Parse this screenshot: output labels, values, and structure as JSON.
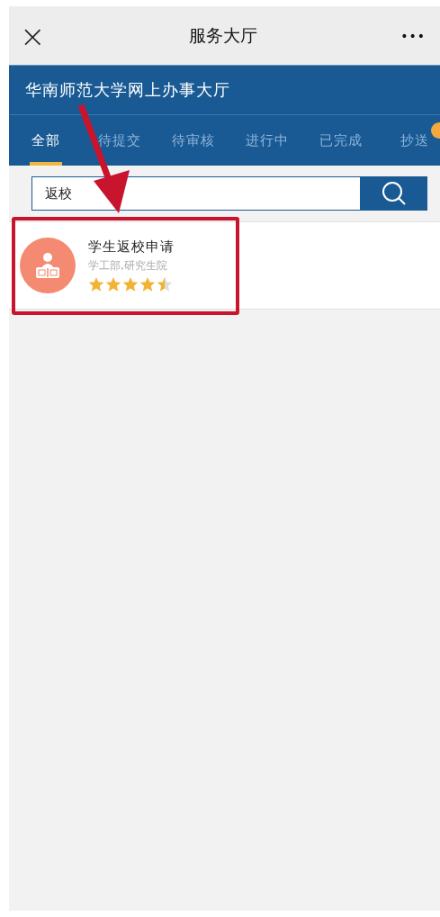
{
  "nav_bar": {
    "close": "×",
    "title": "服务大厅",
    "more": "•••"
  },
  "header": {
    "title": "华南师范大学网上办事大厅"
  },
  "tabs": [
    {
      "label": "全部",
      "selected": true
    },
    {
      "label": "待提交",
      "selected": false
    },
    {
      "label": "待审核",
      "selected": false
    },
    {
      "label": "进行中",
      "selected": false
    },
    {
      "label": "已完成",
      "selected": false
    },
    {
      "label": "抄送",
      "selected": false
    }
  ],
  "search": {
    "value": "返校"
  },
  "results": [
    {
      "title": "学生返校申请",
      "departments": "学工部,研究生院",
      "stars": 4.5,
      "highlighted": true
    }
  ]
}
